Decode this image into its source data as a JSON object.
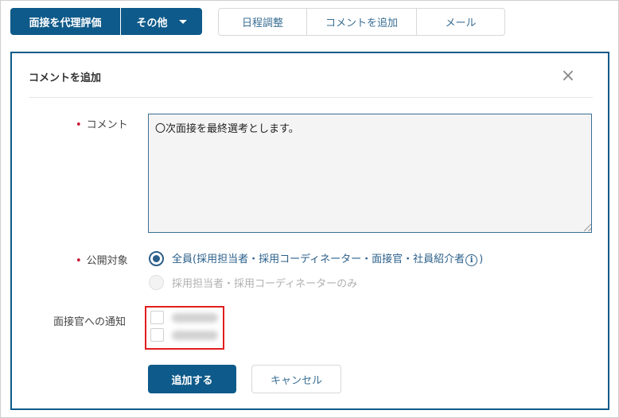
{
  "toolbar": {
    "proxy_eval_label": "面接を代理評価",
    "other_label": "その他",
    "schedule_label": "日程調整",
    "add_comment_label": "コメントを追加",
    "mail_label": "メール"
  },
  "modal": {
    "title": "コメントを追加",
    "close_symbol": "×",
    "comment": {
      "label": "コメント",
      "value": "〇次面接を最終選考とします。"
    },
    "scope": {
      "label": "公開対象",
      "option_all_before": "全員(採用担当者・採用コーディネーター・面接官・社員紹介者",
      "option_all_after": ")",
      "option_limited": "採用担当者・採用コーディネーターのみ",
      "selected": "all"
    },
    "notify": {
      "label": "面接官への通知"
    },
    "submit_label": "追加する",
    "cancel_label": "キャンセル"
  },
  "colors": {
    "brand": "#0e5a8a",
    "required_mark": "#c8102e",
    "highlight": "#e01e1e"
  },
  "icons": {
    "info": "i",
    "caret": "chevron-down-icon"
  }
}
